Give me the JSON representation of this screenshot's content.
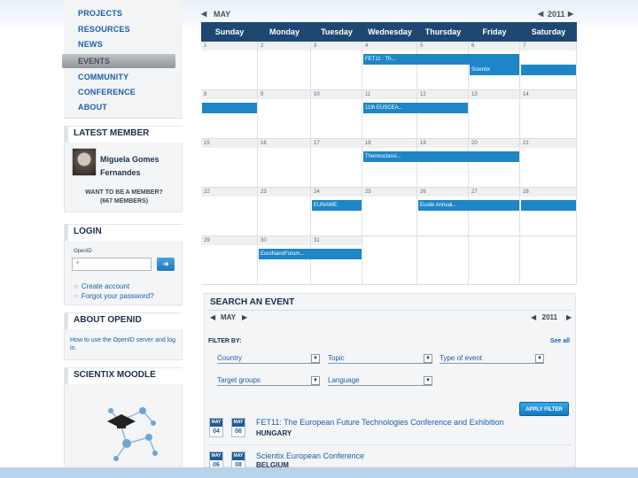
{
  "nav": {
    "items": [
      "PROJECTS",
      "RESOURCES",
      "NEWS",
      "EVENTS",
      "COMMUNITY",
      "CONFERENCE",
      "ABOUT"
    ],
    "active": "EVENTS"
  },
  "latest_member": {
    "title": "LATEST MEMBER",
    "name_line1": "Miguela Gomes",
    "name_line2": "Fernandes",
    "question": "WANT TO BE A MEMBER?",
    "count": "(667 MEMBERS)"
  },
  "login": {
    "title": "LOGIN",
    "field_label": "OpenID",
    "input_value": "+",
    "go_icon": "arrow-right-icon",
    "links": [
      "Create account",
      "Forgot your password?"
    ]
  },
  "about_openid": {
    "title": "ABOUT OPENID",
    "text": "How to use the OpenID server and log in."
  },
  "moodle": {
    "title": "SCIENTIX MOODLE"
  },
  "calendar": {
    "month": "MAY",
    "year": "2011",
    "days": [
      "Sunday",
      "Monday",
      "Tuesday",
      "Wednesday",
      "Thursday",
      "Friday",
      "Saturday"
    ],
    "weeks": [
      [
        "1",
        "2",
        "3",
        "4",
        "5",
        "6",
        "7"
      ],
      [
        "8",
        "9",
        "10",
        "11",
        "12",
        "13",
        "14"
      ],
      [
        "15",
        "16",
        "17",
        "18",
        "19",
        "20",
        "21"
      ],
      [
        "22",
        "23",
        "24",
        "25",
        "26",
        "27",
        "28"
      ],
      [
        "29",
        "30",
        "31",
        "",
        "",
        "",
        ""
      ]
    ],
    "events": [
      {
        "label": "FET11 : Th...",
        "week": 0,
        "start": 3,
        "span": 3
      },
      {
        "label": "Scientix",
        "week": 0,
        "start": 5,
        "span": 1
      },
      {
        "label": "",
        "week": 0,
        "start": 6,
        "span": 1
      },
      {
        "label": "",
        "week": 1,
        "start": 0,
        "span": 1
      },
      {
        "label": "11th EUSCEA...",
        "week": 1,
        "start": 3,
        "span": 2
      },
      {
        "label": "Thermoclassi...",
        "week": 2,
        "start": 3,
        "span": 3
      },
      {
        "label": "EUNAWE:",
        "week": 3,
        "start": 2,
        "span": 1
      },
      {
        "label": "Euslie Annual...",
        "week": 3,
        "start": 4,
        "span": 2
      },
      {
        "label": "",
        "week": 3,
        "start": 6,
        "span": 1
      },
      {
        "label": "EuroNanoForum...",
        "week": 4,
        "start": 1,
        "span": 2
      }
    ]
  },
  "search": {
    "title": "SEARCH AN EVENT",
    "month": "MAY",
    "year": "2011",
    "filter_by": "FILTER BY:",
    "see_all": "See all",
    "filters_row1": [
      "Country",
      "Topic",
      "Type of event"
    ],
    "filters_row2": [
      "Target groups",
      "Language"
    ],
    "apply": "APPLY FILTER",
    "results": [
      {
        "m1": "MAY",
        "d1": "04",
        "m2": "MAY",
        "d2": "06",
        "title": "FET11: The European Future Technologies Conference and Exhibition",
        "country": "HUNGARY"
      },
      {
        "m1": "MAY",
        "d1": "06",
        "m2": "MAY",
        "d2": "08",
        "title": "Scientix European Conference",
        "country": "BELGIUM"
      }
    ]
  }
}
